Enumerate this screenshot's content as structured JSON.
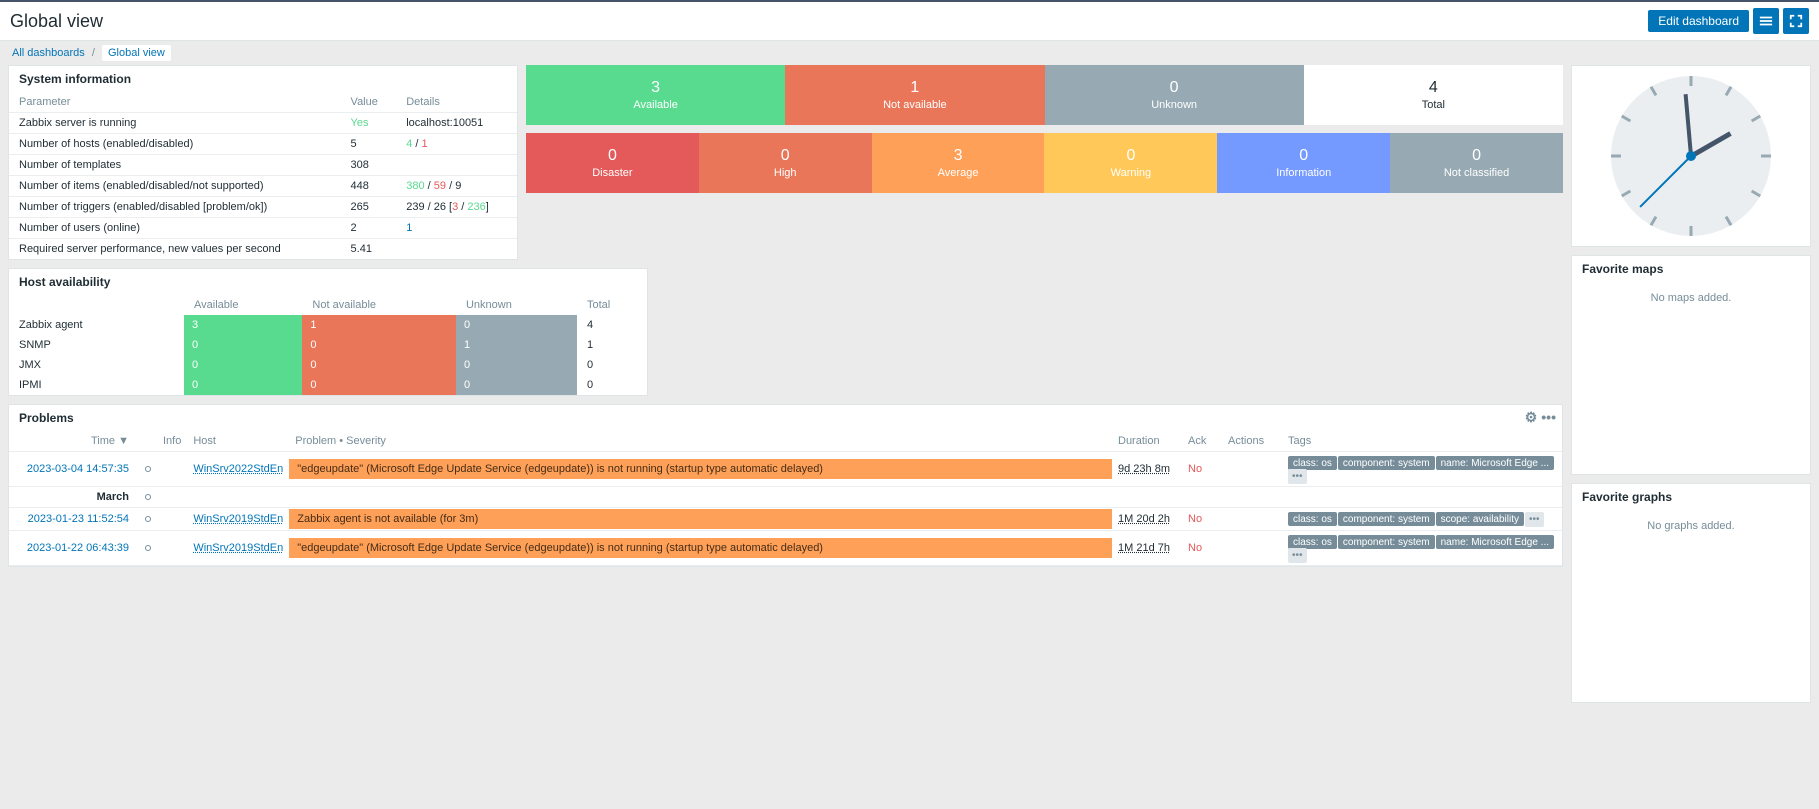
{
  "page": {
    "title": "Global view",
    "edit_btn": "Edit dashboard"
  },
  "breadcrumbs": {
    "all": "All dashboards",
    "current": "Global view"
  },
  "sysinfo": {
    "title": "System information",
    "headers": {
      "param": "Parameter",
      "value": "Value",
      "details": "Details"
    },
    "rows": [
      {
        "param": "Zabbix server is running",
        "value": "Yes",
        "value_class": "green-t",
        "details": "localhost:10051"
      },
      {
        "param": "Number of hosts (enabled/disabled)",
        "value": "5",
        "details_parts": [
          {
            "t": "4",
            "c": "green-t"
          },
          {
            "t": " / ",
            "c": ""
          },
          {
            "t": "1",
            "c": "red-t"
          }
        ]
      },
      {
        "param": "Number of templates",
        "value": "308",
        "details": ""
      },
      {
        "param": "Number of items (enabled/disabled/not supported)",
        "value": "448",
        "details_parts": [
          {
            "t": "380",
            "c": "green-t"
          },
          {
            "t": " / ",
            "c": ""
          },
          {
            "t": "59",
            "c": "red-t"
          },
          {
            "t": " / ",
            "c": ""
          },
          {
            "t": "9",
            "c": ""
          }
        ]
      },
      {
        "param": "Number of triggers (enabled/disabled [problem/ok])",
        "value": "265",
        "details_parts": [
          {
            "t": "239 / 26 [",
            "c": ""
          },
          {
            "t": "3",
            "c": "red-t"
          },
          {
            "t": " / ",
            "c": ""
          },
          {
            "t": "236",
            "c": "green-t"
          },
          {
            "t": "]",
            "c": ""
          }
        ]
      },
      {
        "param": "Number of users (online)",
        "value": "2",
        "details_parts": [
          {
            "t": "1",
            "c": "blue-t"
          }
        ]
      },
      {
        "param": "Required server performance, new values per second",
        "value": "5.41",
        "details": ""
      }
    ]
  },
  "host_tiles": {
    "row1": [
      {
        "num": "3",
        "label": "Available",
        "cls": "t-green"
      },
      {
        "num": "1",
        "label": "Not available",
        "cls": "t-red"
      },
      {
        "num": "0",
        "label": "Unknown",
        "cls": "t-gray"
      },
      {
        "num": "4",
        "label": "Total",
        "cls": "t-white"
      }
    ],
    "row2": [
      {
        "num": "0",
        "label": "Disaster",
        "cls": "t-disaster"
      },
      {
        "num": "0",
        "label": "High",
        "cls": "t-high"
      },
      {
        "num": "3",
        "label": "Average",
        "cls": "t-avg"
      },
      {
        "num": "0",
        "label": "Warning",
        "cls": "t-warn"
      },
      {
        "num": "0",
        "label": "Information",
        "cls": "t-info"
      },
      {
        "num": "0",
        "label": "Not classified",
        "cls": "t-na"
      }
    ]
  },
  "host_av": {
    "title": "Host availability",
    "headers": {
      "blank": "",
      "avail": "Available",
      "notavail": "Not available",
      "unk": "Unknown",
      "tot": "Total"
    },
    "rows": [
      {
        "label": "Zabbix agent",
        "a": "3",
        "n": "1",
        "u": "0",
        "t": "4"
      },
      {
        "label": "SNMP",
        "a": "0",
        "n": "0",
        "u": "1",
        "t": "1"
      },
      {
        "label": "JMX",
        "a": "0",
        "n": "0",
        "u": "0",
        "t": "0"
      },
      {
        "label": "IPMI",
        "a": "0",
        "n": "0",
        "u": "0",
        "t": "0"
      }
    ]
  },
  "problems": {
    "title": "Problems",
    "headers": {
      "time": "Time",
      "info": "Info",
      "host": "Host",
      "problem": "Problem • Severity",
      "dur": "Duration",
      "ack": "Ack",
      "actions": "Actions",
      "tags": "Tags"
    },
    "divider": "March",
    "rows": [
      {
        "time": "2023-03-04 14:57:35",
        "host": "WinSrv2022StdEn",
        "problem": "\"edgeupdate\" (Microsoft Edge Update Service (edgeupdate)) is not running (startup type automatic delayed)",
        "dur": "9d 23h 8m",
        "ack": "No",
        "tags": [
          "class: os",
          "component: system",
          "name: Microsoft Edge ..."
        ]
      },
      {
        "time": "2023-01-23 11:52:54",
        "host": "WinSrv2019StdEn",
        "problem": "Zabbix agent is not available (for 3m)",
        "dur": "1M 20d 2h",
        "ack": "No",
        "tags": [
          "class: os",
          "component: system",
          "scope: availability"
        ]
      },
      {
        "time": "2023-01-22 06:43:39",
        "host": "WinSrv2019StdEn",
        "problem": "\"edgeupdate\" (Microsoft Edge Update Service (edgeupdate)) is not running (startup type automatic delayed)",
        "dur": "1M 21d 7h",
        "ack": "No",
        "tags": [
          "class: os",
          "component: system",
          "name: Microsoft Edge ..."
        ]
      }
    ]
  },
  "side": {
    "fav_maps": {
      "title": "Favorite maps",
      "empty": "No maps added."
    },
    "fav_graphs": {
      "title": "Favorite graphs",
      "empty": "No graphs added."
    }
  },
  "sort_arrow": "▼"
}
